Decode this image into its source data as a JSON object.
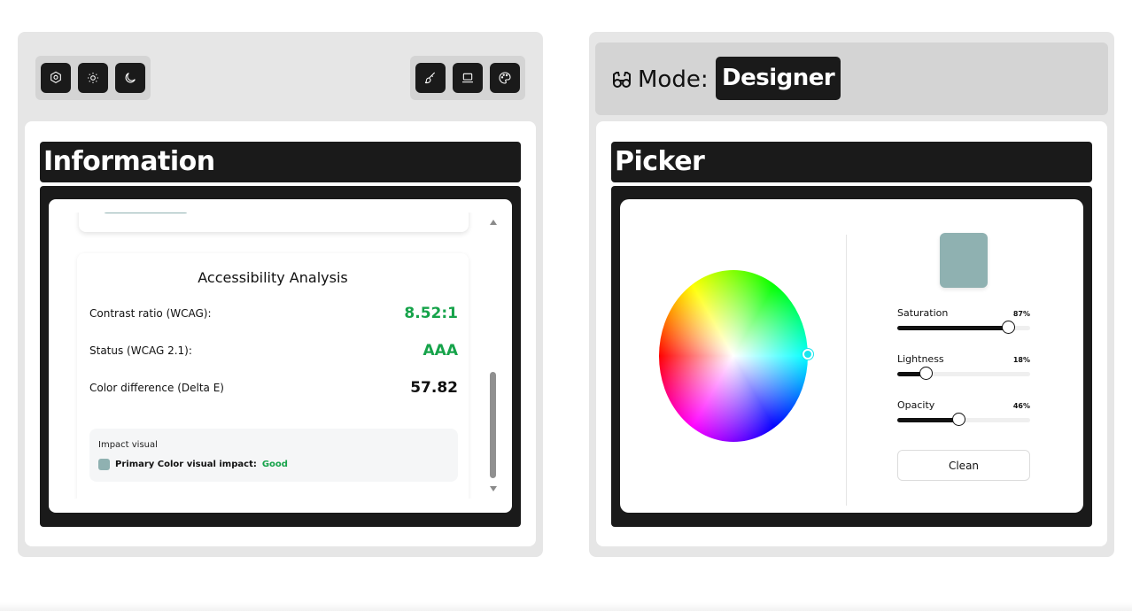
{
  "left_panel": {
    "toolbar_left": [
      "settings-icon",
      "sun-icon",
      "moon-icon"
    ],
    "toolbar_right": [
      "brush-icon",
      "laptop-icon",
      "palette-icon"
    ],
    "section_title": "Information",
    "accessibility": {
      "title": "Accessibility Analysis",
      "rows": [
        {
          "label": "Contrast ratio (WCAG):",
          "value": "8.52:1",
          "color": "#16a34a"
        },
        {
          "label": "Status (WCAG 2.1):",
          "value": "AAA",
          "color": "#16a34a"
        },
        {
          "label": "Color difference (Delta E)",
          "value": "57.82",
          "color": "#111111"
        }
      ],
      "impact": {
        "title": "Impact visual",
        "label": "Primary Color visual impact:",
        "value": "Good",
        "swatch_color": "#8fb1b1"
      }
    }
  },
  "right_panel": {
    "mode_label": "Mode:",
    "mode_value": "Designer",
    "section_title": "Picker",
    "swatch_color": "#8fb1b1",
    "sliders": [
      {
        "name": "Saturation",
        "value": "87%",
        "fraction": 0.83
      },
      {
        "name": "Lightness",
        "value": "18%",
        "fraction": 0.21
      },
      {
        "name": "Opacity",
        "value": "46%",
        "fraction": 0.46
      }
    ],
    "clean_label": "Clean"
  }
}
